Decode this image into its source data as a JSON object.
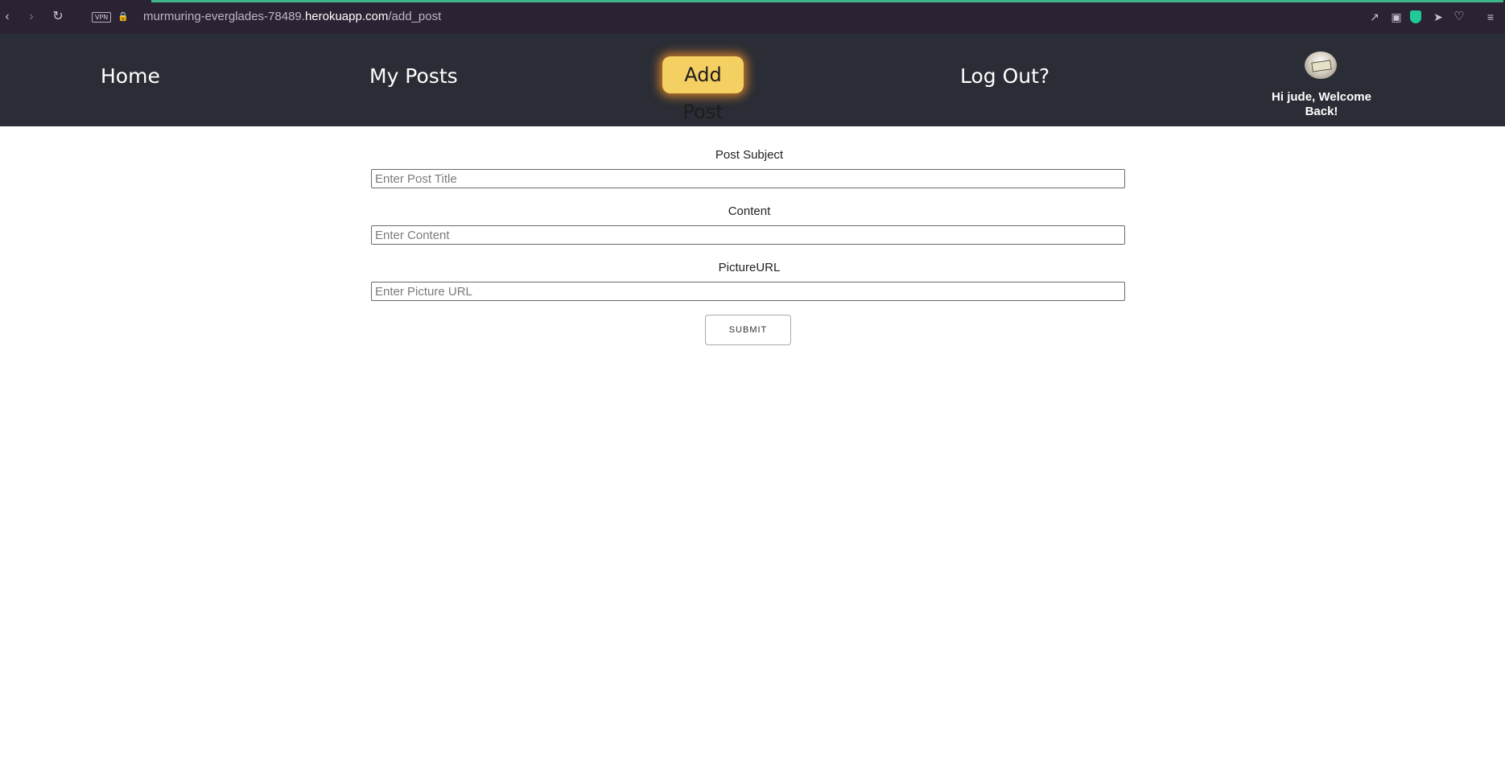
{
  "browser": {
    "vpn_label": "VPN",
    "url_prefix": "murmuring-everglades-78489.",
    "url_host": "herokuapp.com",
    "url_path": "/add_post"
  },
  "nav": {
    "home": "Home",
    "my_posts": "My Posts",
    "add_post": "Add Post",
    "log_out": "Log Out?",
    "welcome": "Hi jude, Welcome Back!"
  },
  "form": {
    "subject_label": "Post Subject",
    "subject_placeholder": "Enter Post Title",
    "content_label": "Content",
    "content_placeholder": "Enter Content",
    "picture_label": "PictureURL",
    "picture_placeholder": "Enter Picture URL",
    "submit_label": "SUBMIT"
  },
  "colors": {
    "nav_bg": "#2a2d35",
    "active_button": "#f4cf62",
    "browser_bg": "#2b2233"
  }
}
